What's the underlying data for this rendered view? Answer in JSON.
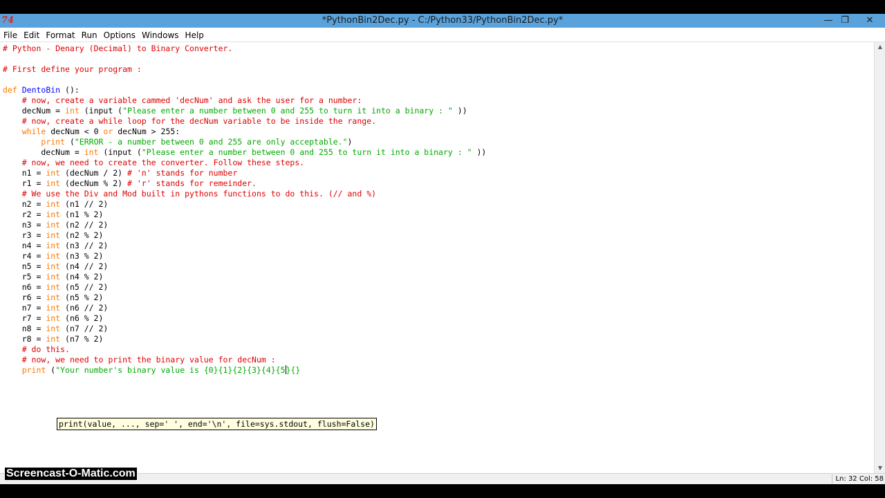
{
  "window": {
    "title": "*PythonBin2Dec.py - C:/Python33/PythonBin2Dec.py*",
    "icon_glyph": "74",
    "minimize_glyph": "—",
    "restore_glyph": "❐",
    "close_glyph": "✕"
  },
  "menu": [
    "File",
    "Edit",
    "Format",
    "Run",
    "Options",
    "Windows",
    "Help"
  ],
  "editor": {
    "lines": [
      [
        [
          "c",
          "# Python - Denary (Decimal) to Binary Converter."
        ]
      ],
      [],
      [
        [
          "c",
          "# First define your program :"
        ]
      ],
      [],
      [
        [
          "k",
          "def"
        ],
        [
          "n",
          " "
        ],
        [
          "d",
          "DentoBin"
        ],
        [
          "n",
          " ():"
        ]
      ],
      [
        [
          "n",
          "    "
        ],
        [
          "c",
          "# now, create a variable cammed 'decNum' and ask the user for a number:"
        ]
      ],
      [
        [
          "n",
          "    decNum = "
        ],
        [
          "k",
          "int"
        ],
        [
          "n",
          " (input ("
        ],
        [
          "s",
          "\"Please enter a number between 0 and 255 to turn it into a binary : \""
        ],
        [
          "n",
          " ))"
        ]
      ],
      [
        [
          "n",
          "    "
        ],
        [
          "c",
          "# now, create a while loop for the decNum variable to be inside the range."
        ]
      ],
      [
        [
          "n",
          "    "
        ],
        [
          "k",
          "while"
        ],
        [
          "n",
          " decNum < 0 "
        ],
        [
          "k",
          "or"
        ],
        [
          "n",
          " decNum > 255:"
        ]
      ],
      [
        [
          "n",
          "        "
        ],
        [
          "k",
          "print"
        ],
        [
          "n",
          " ("
        ],
        [
          "s",
          "\"ERROR - a number between 0 and 255 are only acceptable.\""
        ],
        [
          "n",
          ")"
        ]
      ],
      [
        [
          "n",
          "        decNum = "
        ],
        [
          "k",
          "int"
        ],
        [
          "n",
          " (input ("
        ],
        [
          "s",
          "\"Please enter a number between 0 and 255 to turn it into a binary : \""
        ],
        [
          "n",
          " ))"
        ]
      ],
      [
        [
          "n",
          "    "
        ],
        [
          "c",
          "# now, we need to create the converter. Follow these steps."
        ]
      ],
      [
        [
          "n",
          "    n1 = "
        ],
        [
          "k",
          "int"
        ],
        [
          "n",
          " (decNum / 2) "
        ],
        [
          "c",
          "# 'n' stands for number"
        ]
      ],
      [
        [
          "n",
          "    r1 = "
        ],
        [
          "k",
          "int"
        ],
        [
          "n",
          " (decNum % 2) "
        ],
        [
          "c",
          "# 'r' stands for remeinder."
        ]
      ],
      [
        [
          "n",
          "    "
        ],
        [
          "c",
          "# We use the Div and Mod built in pythons functions to do this. (// and %)"
        ]
      ],
      [
        [
          "n",
          "    n2 = "
        ],
        [
          "k",
          "int"
        ],
        [
          "n",
          " (n1 // 2)"
        ]
      ],
      [
        [
          "n",
          "    r2 = "
        ],
        [
          "k",
          "int"
        ],
        [
          "n",
          " (n1 % 2)"
        ]
      ],
      [
        [
          "n",
          "    n3 = "
        ],
        [
          "k",
          "int"
        ],
        [
          "n",
          " (n2 // 2)"
        ]
      ],
      [
        [
          "n",
          "    r3 = "
        ],
        [
          "k",
          "int"
        ],
        [
          "n",
          " (n2 % 2)"
        ]
      ],
      [
        [
          "n",
          "    n4 = "
        ],
        [
          "k",
          "int"
        ],
        [
          "n",
          " (n3 // 2)"
        ]
      ],
      [
        [
          "n",
          "    r4 = "
        ],
        [
          "k",
          "int"
        ],
        [
          "n",
          " (n3 % 2)"
        ]
      ],
      [
        [
          "n",
          "    n5 = "
        ],
        [
          "k",
          "int"
        ],
        [
          "n",
          " (n4 // 2)"
        ]
      ],
      [
        [
          "n",
          "    r5 = "
        ],
        [
          "k",
          "int"
        ],
        [
          "n",
          " (n4 % 2)"
        ]
      ],
      [
        [
          "n",
          "    n6 = "
        ],
        [
          "k",
          "int"
        ],
        [
          "n",
          " (n5 // 2)"
        ]
      ],
      [
        [
          "n",
          "    r6 = "
        ],
        [
          "k",
          "int"
        ],
        [
          "n",
          " (n5 % 2)"
        ]
      ],
      [
        [
          "n",
          "    n7 = "
        ],
        [
          "k",
          "int"
        ],
        [
          "n",
          " (n6 // 2)"
        ]
      ],
      [
        [
          "n",
          "    r7 = "
        ],
        [
          "k",
          "int"
        ],
        [
          "n",
          " (n6 % 2)"
        ]
      ],
      [
        [
          "n",
          "    n8 = "
        ],
        [
          "k",
          "int"
        ],
        [
          "n",
          " (n7 // 2)"
        ]
      ],
      [
        [
          "n",
          "    r8 = "
        ],
        [
          "k",
          "int"
        ],
        [
          "n",
          " (n7 % 2)"
        ]
      ],
      [
        [
          "n",
          "    "
        ],
        [
          "c",
          "# do this."
        ]
      ],
      [
        [
          "n",
          "    "
        ],
        [
          "c",
          "# now, we need to print the binary value for decNum :"
        ]
      ],
      [
        [
          "n",
          "    "
        ],
        [
          "k",
          "print"
        ],
        [
          "n",
          " ("
        ],
        [
          "s",
          "\"Your number's binary value is {0}{1}{2}{3}{4}{5"
        ],
        [
          "cursor",
          ""
        ],
        [
          "s",
          "}{}"
        ]
      ]
    ],
    "calltip": "print(value, ..., sep=' ', end='\\n', file=sys.stdout, flush=False)"
  },
  "status": {
    "position": "Ln: 32 Col: 58"
  },
  "watermark": "Screencast-O-Matic.com",
  "colors": {
    "comment": "#dd0000",
    "keyword": "#ff7700",
    "string": "#00aa00",
    "definition": "#0000ff",
    "titlebar": "#5aa2db"
  }
}
